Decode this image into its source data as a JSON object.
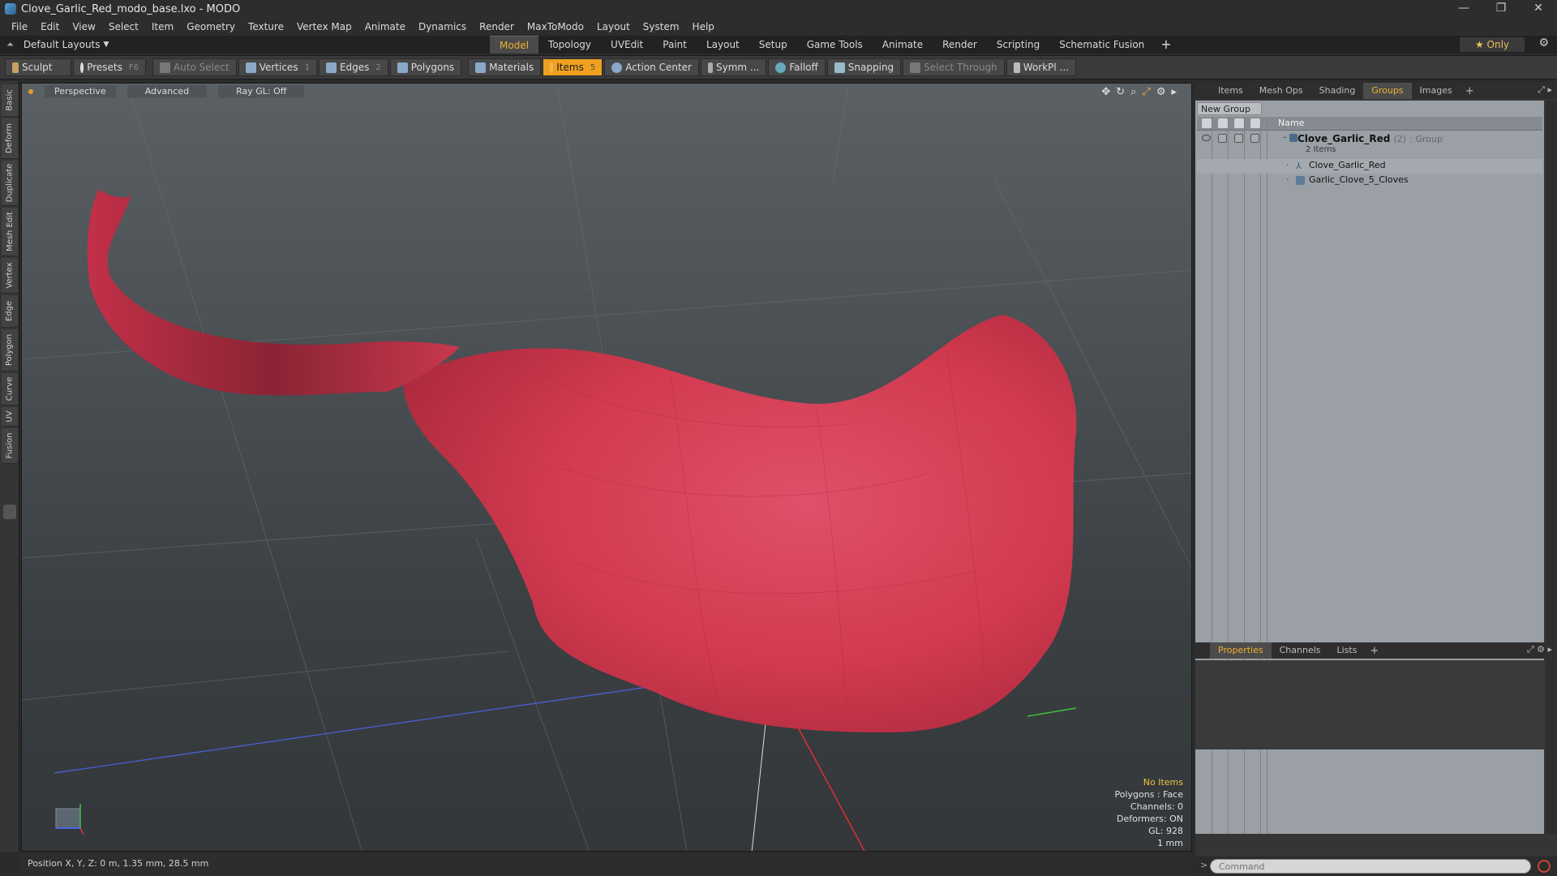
{
  "window": {
    "title": "Clove_Garlic_Red_modo_base.lxo - MODO",
    "controls": [
      "—",
      "❐",
      "✕"
    ]
  },
  "menu": [
    "File",
    "Edit",
    "View",
    "Select",
    "Item",
    "Geometry",
    "Texture",
    "Vertex Map",
    "Animate",
    "Dynamics",
    "Render",
    "MaxToModo",
    "Layout",
    "System",
    "Help"
  ],
  "layout_bar": {
    "layouts_label": "Default Layouts",
    "tabs": [
      "Model",
      "Topology",
      "UVEdit",
      "Paint",
      "Layout",
      "Setup",
      "Game Tools",
      "Animate",
      "Render",
      "Scripting",
      "Schematic Fusion"
    ],
    "active_tab": "Model",
    "add": "+",
    "only_label": "★  Only"
  },
  "toolbar": {
    "sculpt": "Sculpt",
    "presets": "Presets",
    "presets_key": "F6",
    "auto_select": "Auto Select",
    "vertices": "Vertices",
    "vertices_key": "1",
    "edges": "Edges",
    "edges_key": "2",
    "polygons": "Polygons",
    "materials": "Materials",
    "items": "Items",
    "items_key": "5",
    "action_center": "Action Center",
    "symm": "Symm ...",
    "falloff": "Falloff",
    "snapping": "Snapping",
    "select_through": "Select Through",
    "workpl": "WorkPl ..."
  },
  "left_tabs": [
    "Basic",
    "Deform",
    "Duplicate",
    "Mesh Edit",
    "Vertex",
    "Edge",
    "Polygon",
    "Curve",
    "UV",
    "Fusion"
  ],
  "viewport": {
    "view": "Perspective",
    "shading": "Advanced",
    "raygl": "Ray GL: Off",
    "info": {
      "selection": "No Items",
      "polygons": "Polygons : Face",
      "channels": "Channels: 0",
      "deformers": "Deformers: ON",
      "gl": "GL: 928",
      "scale": "1 mm"
    },
    "colors": {
      "mesh": "#d23a4f",
      "x_axis": "#e03030",
      "y_axis": "#40c040",
      "z_axis": "#4060e0"
    }
  },
  "statusbar": {
    "position": "Position X, Y, Z:  0 m, 1.35 mm, 28.5 mm"
  },
  "right_panel": {
    "tabs": [
      "Items",
      "Mesh Ops",
      "Shading",
      "Groups",
      "Images"
    ],
    "active_tab": "Groups",
    "new_group": "New Group",
    "column_name": "Name",
    "group": {
      "name": "Clove_Garlic_Red",
      "count": "(2)",
      "type": ": Group",
      "sub": "2 Items",
      "children": [
        "Clove_Garlic_Red",
        "Garlic_Clove_5_Cloves"
      ]
    },
    "bottom_tabs": [
      "Properties",
      "Channels",
      "Lists"
    ],
    "bottom_active": "Properties",
    "command_placeholder": "Command"
  }
}
